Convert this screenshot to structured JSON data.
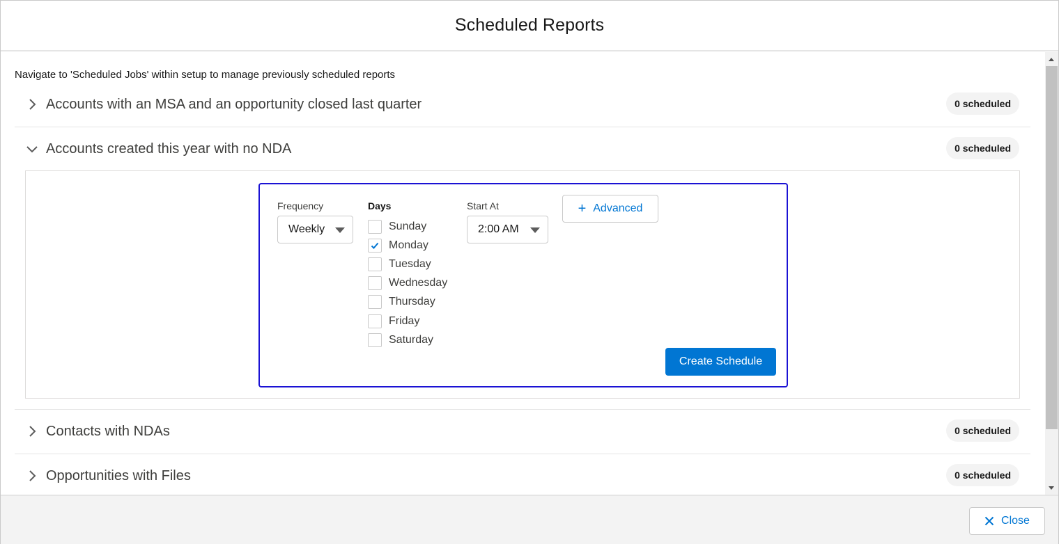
{
  "modal": {
    "title": "Scheduled Reports",
    "note": "Navigate to 'Scheduled Jobs' within setup to manage previously scheduled reports"
  },
  "reports": [
    {
      "title": "Accounts with an MSA and an opportunity closed last quarter",
      "badge": "0 scheduled",
      "expanded": false
    },
    {
      "title": "Accounts created this year with no NDA",
      "badge": "0 scheduled",
      "expanded": true
    },
    {
      "title": "Contacts with NDAs",
      "badge": "0 scheduled",
      "expanded": false
    },
    {
      "title": "Opportunities with Files",
      "badge": "0 scheduled",
      "expanded": false
    }
  ],
  "schedule_form": {
    "frequency_label": "Frequency",
    "frequency_value": "Weekly",
    "days_label": "Days",
    "days": [
      {
        "label": "Sunday",
        "checked": false
      },
      {
        "label": "Monday",
        "checked": true
      },
      {
        "label": "Tuesday",
        "checked": false
      },
      {
        "label": "Wednesday",
        "checked": false
      },
      {
        "label": "Thursday",
        "checked": false
      },
      {
        "label": "Friday",
        "checked": false
      },
      {
        "label": "Saturday",
        "checked": false
      }
    ],
    "start_label": "Start At",
    "start_value": "2:00 AM",
    "advanced_label": "Advanced",
    "create_label": "Create Schedule"
  },
  "footer": {
    "close_label": "Close"
  },
  "colors": {
    "brand": "#0176d3",
    "focus_border": "#1b12d4"
  }
}
